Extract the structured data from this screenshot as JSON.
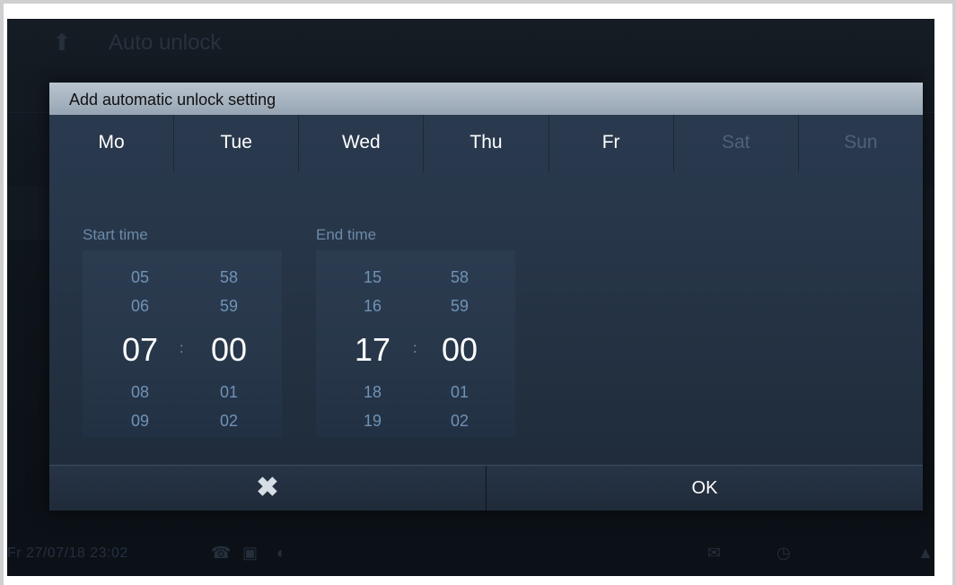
{
  "background": {
    "title": "Auto unlock",
    "status_text": "Fr 27/07/18  23:02"
  },
  "dialog": {
    "title": "Add automatic unlock setting",
    "days": [
      {
        "label": "Mo",
        "active": true
      },
      {
        "label": "Tue",
        "active": true
      },
      {
        "label": "Wed",
        "active": true
      },
      {
        "label": "Thu",
        "active": true
      },
      {
        "label": "Fr",
        "active": true
      },
      {
        "label": "Sat",
        "active": false
      },
      {
        "label": "Sun",
        "active": false
      }
    ],
    "start_time": {
      "label": "Start time",
      "hours": {
        "above": [
          "05",
          "06"
        ],
        "selected": "07",
        "below": [
          "08",
          "09"
        ]
      },
      "minutes": {
        "above": [
          "58",
          "59"
        ],
        "selected": "00",
        "below": [
          "01",
          "02"
        ]
      },
      "separator": ":"
    },
    "end_time": {
      "label": "End time",
      "hours": {
        "above": [
          "15",
          "16"
        ],
        "selected": "17",
        "below": [
          "18",
          "19"
        ]
      },
      "minutes": {
        "above": [
          "58",
          "59"
        ],
        "selected": "00",
        "below": [
          "01",
          "02"
        ]
      },
      "separator": ":"
    },
    "cancel_icon": "close-icon",
    "ok_label": "OK"
  },
  "colors": {
    "day_active": "#ffffff",
    "day_inactive": "#4f6278",
    "title_bar": "#a9b5c1",
    "dialog_bg": "#273649"
  }
}
